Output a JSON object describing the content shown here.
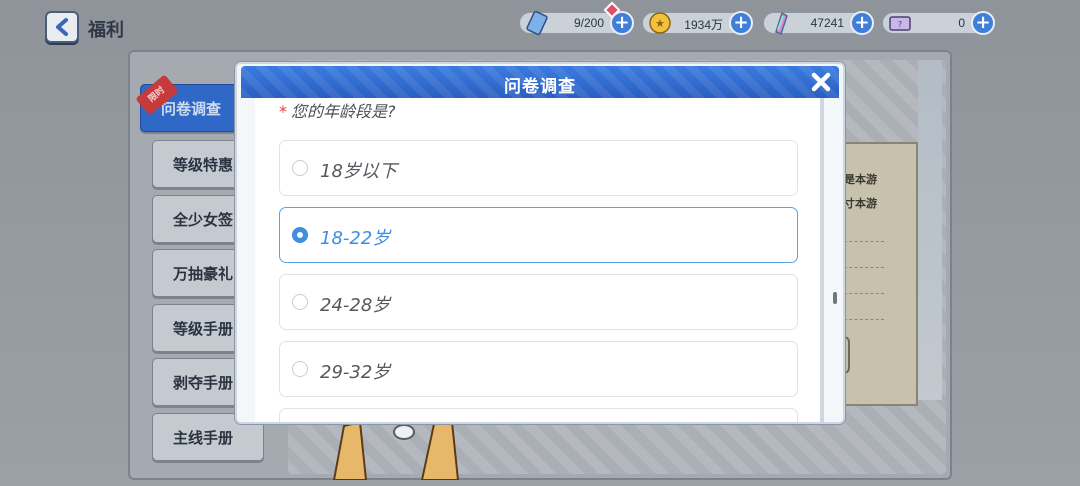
{
  "header": {
    "title": "福利",
    "resources": [
      {
        "icon": "stamina-icon",
        "value": "9/200",
        "has_alert": true
      },
      {
        "icon": "gold-coin-icon",
        "value": "1934万",
        "has_alert": false
      },
      {
        "icon": "crystal-icon",
        "value": "47241",
        "has_alert": false
      },
      {
        "icon": "ticket-icon",
        "value": "0",
        "has_alert": false
      }
    ]
  },
  "sidebar": {
    "items": [
      {
        "label": "问卷调查",
        "active": true,
        "badge": "限时"
      },
      {
        "label": "等级特惠"
      },
      {
        "label": "全少女签"
      },
      {
        "label": "万抽豪礼"
      },
      {
        "label": "等级手册"
      },
      {
        "label": "剥夺手册"
      },
      {
        "label": "主线手册"
      }
    ]
  },
  "background_card": {
    "lines": [
      "是本游",
      "寸本游"
    ]
  },
  "modal": {
    "title": "问卷调查",
    "question": {
      "required_mark": "*",
      "text": "您的年龄段是?",
      "options": [
        {
          "label": "18岁以下",
          "selected": false
        },
        {
          "label": "18-22岁",
          "selected": true
        },
        {
          "label": "24-28岁",
          "selected": false
        },
        {
          "label": "29-32岁",
          "selected": false
        }
      ]
    }
  },
  "colors": {
    "accent": "#3e8fe0",
    "header_blue": "#2f68c7",
    "required": "#e53b3b"
  }
}
